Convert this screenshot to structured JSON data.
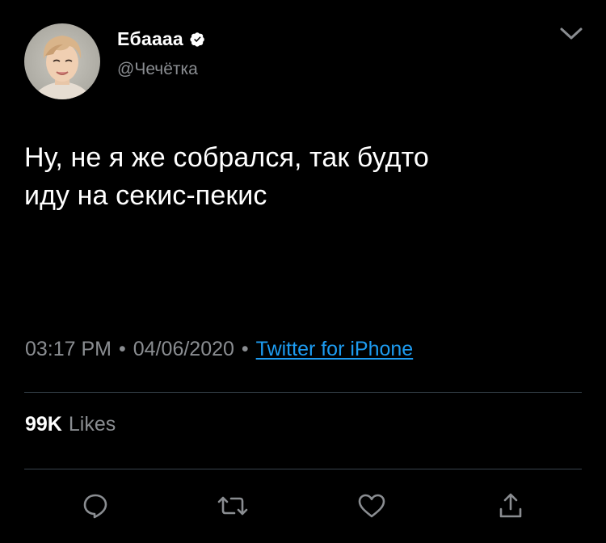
{
  "author": {
    "display_name": "Ебаааа",
    "handle": "@Чечётка",
    "verified": true
  },
  "tweet": {
    "text": "Ну, не я же собрался, так будто\nиду на секис-пекис"
  },
  "meta": {
    "time": "03:17 PM",
    "separator": "•",
    "date": "04/06/2020",
    "source": "Twitter for iPhone"
  },
  "stats": {
    "likes_count": "99K",
    "likes_label": "Likes"
  },
  "icons": {
    "verified": "verified-badge-icon",
    "menu": "chevron-down-icon",
    "reply": "reply-icon",
    "retweet": "retweet-icon",
    "like": "heart-icon",
    "share": "share-icon"
  },
  "colors": {
    "background": "#000000",
    "text": "#ffffff",
    "secondary": "#8a8d91",
    "link": "#1d9bf0",
    "divider": "#38444d"
  }
}
